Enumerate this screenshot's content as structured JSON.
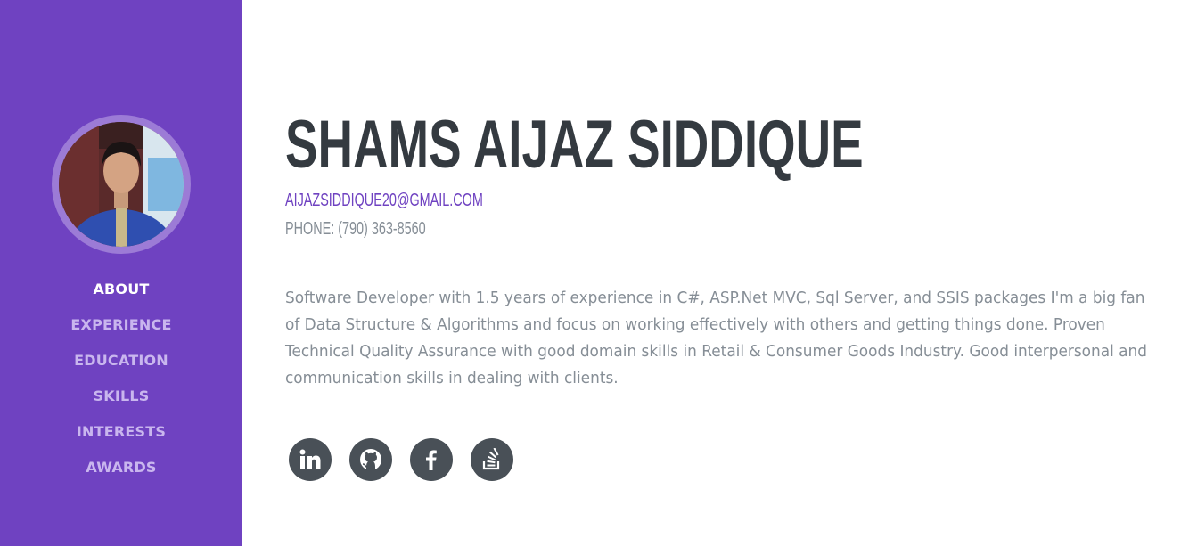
{
  "profile": {
    "name": "SHAMS AIJAZ SIDDIQUE",
    "email": "AIJAZSIDDIQUE20@GMAIL.COM",
    "phone": "PHONE: (790) 363-8560",
    "bio": "Software Developer with 1.5 years of experience in C#, ASP.Net MVC, Sql Server, and SSIS packages I'm a big fan of Data Structure & Algorithms and focus on working effectively with others and getting things done. Proven Technical Quality Assurance with good domain skills in Retail & Consumer Goods Industry. Good interpersonal and communication skills in dealing with clients."
  },
  "sidebar": {
    "nav": [
      {
        "label": "ABOUT",
        "active": true
      },
      {
        "label": "EXPERIENCE",
        "active": false
      },
      {
        "label": "EDUCATION",
        "active": false
      },
      {
        "label": "SKILLS",
        "active": false
      },
      {
        "label": "INTERESTS",
        "active": false
      },
      {
        "label": "AWARDS",
        "active": false
      }
    ]
  },
  "social": [
    {
      "icon": "linkedin-icon"
    },
    {
      "icon": "github-icon"
    },
    {
      "icon": "facebook-icon"
    },
    {
      "icon": "stack-overflow-icon"
    }
  ],
  "colors": {
    "sidebar": "#6f42c1",
    "accent": "#6f42c1",
    "heading": "#343a40",
    "muted": "#868e96",
    "social_bg": "#495057"
  }
}
